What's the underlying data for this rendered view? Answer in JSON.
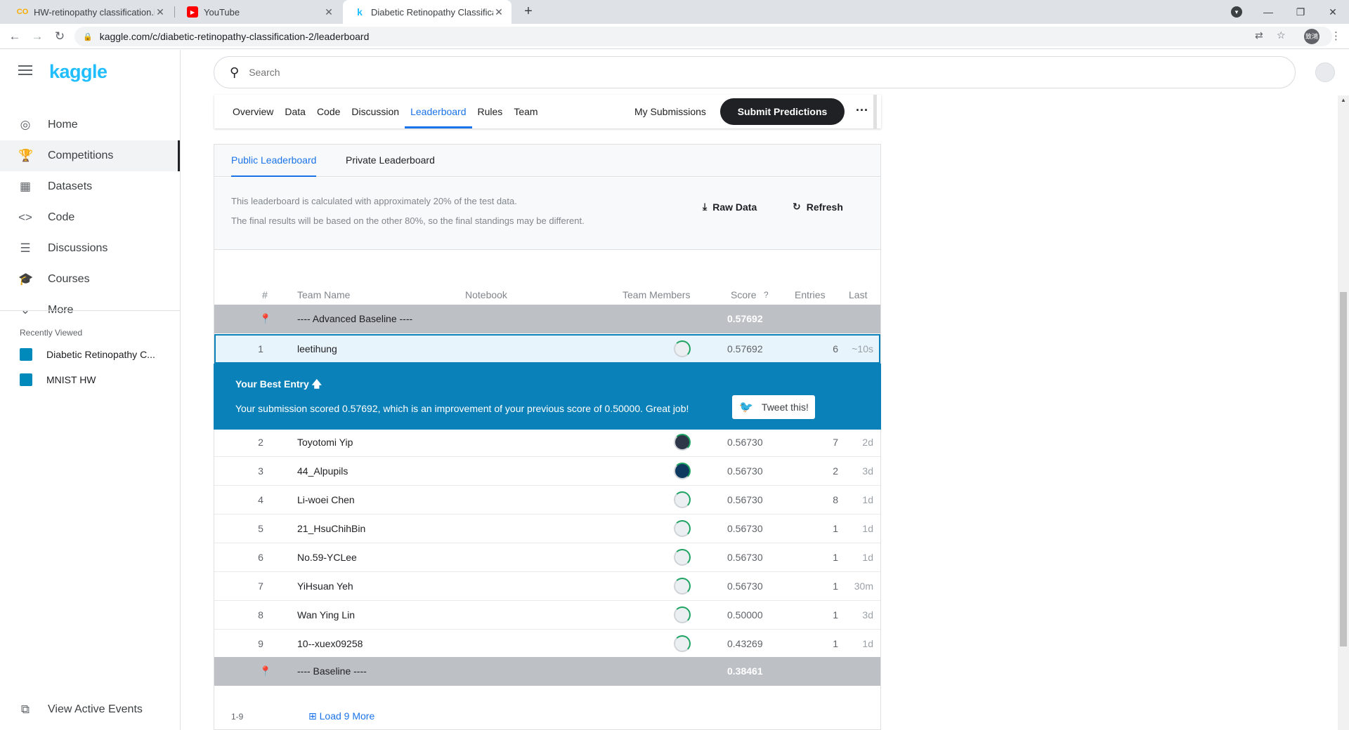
{
  "browser": {
    "tabs": [
      {
        "title": "HW-retinopathy classification.i",
        "favicon": "colab-icon"
      },
      {
        "title": "YouTube",
        "favicon": "youtube-icon"
      },
      {
        "title": "Diabetic Retinopathy Classifica",
        "favicon": "kaggle-icon"
      }
    ],
    "url": "kaggle.com/c/diabetic-retinopathy-classification-2/leaderboard",
    "profile_initials": "致鴻"
  },
  "sidebar": {
    "logo": "kaggle",
    "items": [
      {
        "label": "Home",
        "icon": "compass-icon"
      },
      {
        "label": "Competitions",
        "icon": "trophy-icon"
      },
      {
        "label": "Datasets",
        "icon": "table-icon"
      },
      {
        "label": "Code",
        "icon": "code-icon"
      },
      {
        "label": "Discussions",
        "icon": "chat-icon"
      },
      {
        "label": "Courses",
        "icon": "graduation-cap-icon"
      },
      {
        "label": "More",
        "icon": "chevron-down-icon"
      }
    ],
    "recently_viewed_heading": "Recently Viewed",
    "recent": [
      {
        "label": "Diabetic Retinopathy C..."
      },
      {
        "label": "MNIST HW"
      }
    ],
    "view_active_events": "View Active Events"
  },
  "search": {
    "placeholder": "Search"
  },
  "competition_tabs": {
    "items": [
      "Overview",
      "Data",
      "Code",
      "Discussion",
      "Leaderboard",
      "Rules",
      "Team"
    ],
    "active": "Leaderboard",
    "my_submissions": "My Submissions",
    "submit": "Submit Predictions"
  },
  "leaderboard": {
    "tabs": [
      "Public Leaderboard",
      "Private Leaderboard"
    ],
    "info_line1": "This leaderboard is calculated with approximately 20% of the test data.",
    "info_line2": "The final results will be based on the other 80%, so the final standings may be different.",
    "raw_data": "Raw Data",
    "refresh": "Refresh",
    "headers": {
      "rank": "#",
      "team": "Team Name",
      "notebook": "Notebook",
      "members": "Team Members",
      "score": "Score",
      "entries": "Entries",
      "last": "Last"
    },
    "advanced_baseline": {
      "name": "---- Advanced Baseline ----",
      "score": "0.57692"
    },
    "me": {
      "rank": "1",
      "team": "leetihung",
      "score": "0.57692",
      "entries": "6",
      "last": "~10s"
    },
    "best_entry": {
      "title": "Your Best Entry",
      "message": "Your submission scored 0.57692, which is an improvement of your previous score of 0.50000. Great job!",
      "tweet": "Tweet this!"
    },
    "rows": [
      {
        "rank": "2",
        "team": "Toyotomi Yip",
        "score": "0.56730",
        "entries": "7",
        "last": "2d"
      },
      {
        "rank": "3",
        "team": "44_Alpupils",
        "score": "0.56730",
        "entries": "2",
        "last": "3d"
      },
      {
        "rank": "4",
        "team": "Li-woei Chen",
        "score": "0.56730",
        "entries": "8",
        "last": "1d"
      },
      {
        "rank": "5",
        "team": "21_HsuChihBin",
        "score": "0.56730",
        "entries": "1",
        "last": "1d"
      },
      {
        "rank": "6",
        "team": "No.59-YCLee",
        "score": "0.56730",
        "entries": "1",
        "last": "1d"
      },
      {
        "rank": "7",
        "team": "YiHsuan Yeh",
        "score": "0.56730",
        "entries": "1",
        "last": "30m"
      },
      {
        "rank": "8",
        "team": "Wan Ying Lin",
        "score": "0.50000",
        "entries": "1",
        "last": "3d"
      },
      {
        "rank": "9",
        "team": "10--xuex09258",
        "score": "0.43269",
        "entries": "1",
        "last": "1d"
      }
    ],
    "baseline": {
      "name": "---- Baseline ----",
      "score": "0.38461"
    },
    "range": "1-9",
    "load_more": "Load 9 More"
  }
}
